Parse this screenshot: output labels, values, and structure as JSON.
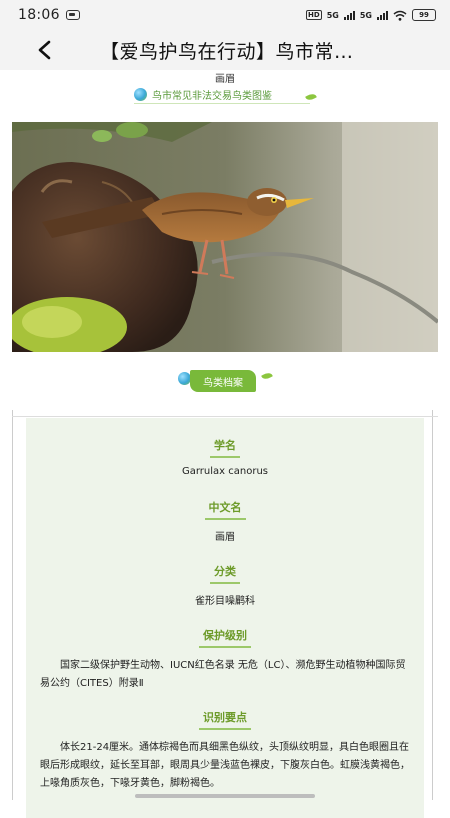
{
  "status": {
    "time": "18:06",
    "hd_label": "HD",
    "net1": "5G",
    "net2": "5G",
    "battery": "99"
  },
  "title_bar": {
    "title": "【爱鸟护鸟在行动】鸟市常…"
  },
  "article": {
    "bird_name": "画眉",
    "series_tag": "鸟市常见非法交易鸟类图鉴",
    "archive_label": "鸟类档案"
  },
  "profile": {
    "scientific": {
      "title": "学名",
      "value": "Garrulax canorus"
    },
    "chinese": {
      "title": "中文名",
      "value": "画眉"
    },
    "classification": {
      "title": "分类",
      "value": "雀形目噪鹛科"
    },
    "protection": {
      "title": "保护级别",
      "value": "国家二级保护野生动物、IUCN红色名录 无危（LC）、濒危野生动植物种国际贸易公约（CITES）附录Ⅱ"
    },
    "identification": {
      "title": "识别要点",
      "value": "体长21-24厘米。通体棕褐色而具细黑色纵纹，头顶纵纹明显，具白色眼圈且在眼后形成眼纹，延长至耳部，眼周具少量浅蓝色裸皮，下腹灰白色。虹膜浅黄褐色，上喙角质灰色，下喙牙黄色，脚粉褐色。"
    }
  },
  "colors": {
    "accent_green": "#79b93a",
    "title_green": "#6d9b2a",
    "card_bg": "#eef4ea"
  }
}
